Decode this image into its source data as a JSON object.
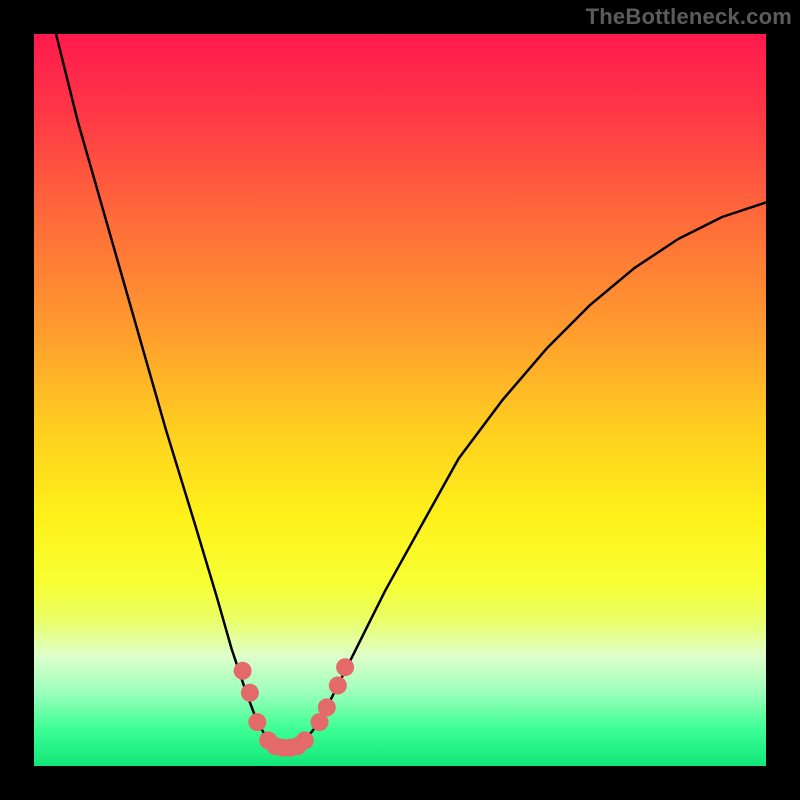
{
  "watermark": "TheBottleneck.com",
  "gradient": {
    "stops": [
      {
        "offset": 0.0,
        "color": "#ff1a4d"
      },
      {
        "offset": 0.1,
        "color": "#ff3547"
      },
      {
        "offset": 0.25,
        "color": "#ff6a3a"
      },
      {
        "offset": 0.4,
        "color": "#ff9a2e"
      },
      {
        "offset": 0.55,
        "color": "#ffd21f"
      },
      {
        "offset": 0.66,
        "color": "#fff11a"
      },
      {
        "offset": 0.75,
        "color": "#f7ff33"
      },
      {
        "offset": 0.8,
        "color": "#eaff66"
      },
      {
        "offset": 0.85,
        "color": "#ddffcc"
      },
      {
        "offset": 0.9,
        "color": "#9bffba"
      },
      {
        "offset": 0.95,
        "color": "#3cff94"
      },
      {
        "offset": 1.0,
        "color": "#11e67a"
      }
    ]
  },
  "chart_data": {
    "type": "line",
    "title": "",
    "xlabel": "",
    "ylabel": "",
    "xlim": [
      0,
      100
    ],
    "ylim": [
      0,
      100
    ],
    "series": [
      {
        "name": "bottleneck-curve",
        "x": [
          3,
          6,
          10,
          14,
          18,
          22,
          25,
          27,
          29,
          30.5,
          32,
          33.5,
          35,
          37,
          39,
          41,
          44,
          48,
          53,
          58,
          64,
          70,
          76,
          82,
          88,
          94,
          100
        ],
        "y": [
          100,
          88,
          74,
          60,
          46,
          33,
          23,
          16,
          10,
          6,
          3.5,
          2.5,
          2.5,
          3.5,
          6,
          10,
          16,
          24,
          33,
          42,
          50,
          57,
          63,
          68,
          72,
          75,
          77
        ]
      }
    ],
    "markers": {
      "name": "highlight-points",
      "color": "#e46a6a",
      "radius_px": 9,
      "points": [
        {
          "x": 28.5,
          "y": 13
        },
        {
          "x": 29.5,
          "y": 10
        },
        {
          "x": 30.5,
          "y": 6
        },
        {
          "x": 32.0,
          "y": 3.5
        },
        {
          "x": 33.0,
          "y": 2.7
        },
        {
          "x": 34.0,
          "y": 2.5
        },
        {
          "x": 35.0,
          "y": 2.5
        },
        {
          "x": 36.0,
          "y": 2.7
        },
        {
          "x": 37.0,
          "y": 3.5
        },
        {
          "x": 39.0,
          "y": 6
        },
        {
          "x": 40.0,
          "y": 8
        },
        {
          "x": 41.5,
          "y": 11
        },
        {
          "x": 42.5,
          "y": 13.5
        }
      ]
    }
  }
}
